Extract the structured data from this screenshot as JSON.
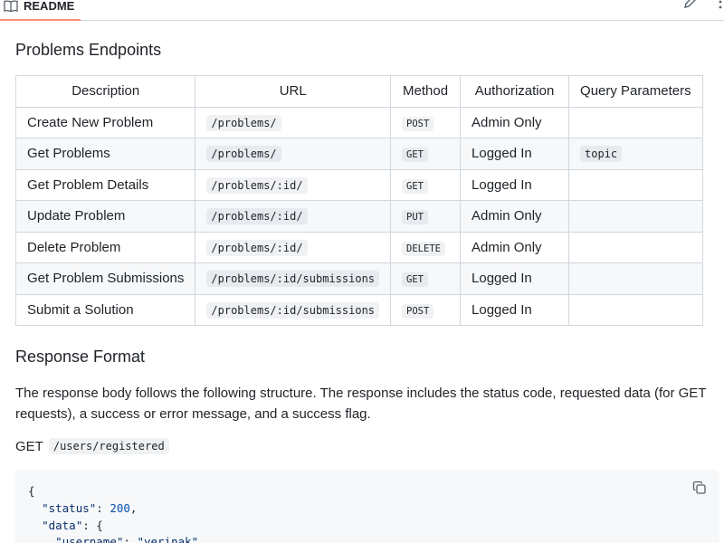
{
  "readme": {
    "tab_label": "README"
  },
  "sections": {
    "endpoints_title": "Problems Endpoints",
    "response_title": "Response Format",
    "response_paragraph": "The response body follows the following structure. The response includes the status code, requested data (for GET requests), a success or error message, and a success flag.",
    "example_method": "GET",
    "example_path": "/users/registered"
  },
  "table": {
    "headers": [
      "Description",
      "URL",
      "Method",
      "Authorization",
      "Query Parameters"
    ],
    "rows": [
      {
        "description": "Create New Problem",
        "url": "/problems/",
        "method": "POST",
        "authorization": "Admin Only",
        "query": ""
      },
      {
        "description": "Get Problems",
        "url": "/problems/",
        "method": "GET",
        "authorization": "Logged In",
        "query": "topic"
      },
      {
        "description": "Get Problem Details",
        "url": "/problems/:id/",
        "method": "GET",
        "authorization": "Logged In",
        "query": ""
      },
      {
        "description": "Update Problem",
        "url": "/problems/:id/",
        "method": "PUT",
        "authorization": "Admin Only",
        "query": ""
      },
      {
        "description": "Delete Problem",
        "url": "/problems/:id/",
        "method": "DELETE",
        "authorization": "Admin Only",
        "query": ""
      },
      {
        "description": "Get Problem Submissions",
        "url": "/problems/:id/submissions",
        "method": "GET",
        "authorization": "Logged In",
        "query": ""
      },
      {
        "description": "Submit a Solution",
        "url": "/problems/:id/submissions",
        "method": "POST",
        "authorization": "Logged In",
        "query": ""
      }
    ]
  },
  "code_block": {
    "lines": [
      {
        "plain": "{"
      },
      {
        "key": "\"status\"",
        "sep": ": ",
        "num": "200",
        "tail": ","
      },
      {
        "key": "\"data\"",
        "sep": ": ",
        "tail": "{"
      },
      {
        "key": "\"username\"",
        "sep": ": ",
        "str": "\"yerinak\"",
        "tail": ","
      }
    ]
  },
  "icons": {
    "readme": "book-icon",
    "edit": "pencil-icon",
    "more": "kebab-icon",
    "copy": "copy-icon"
  },
  "colors": {
    "tab_underline": "#fd8c73",
    "border": "#d0d7de",
    "stripe": "#f6f8fa",
    "code_string": "#0a3069",
    "code_number": "#0550ae"
  }
}
